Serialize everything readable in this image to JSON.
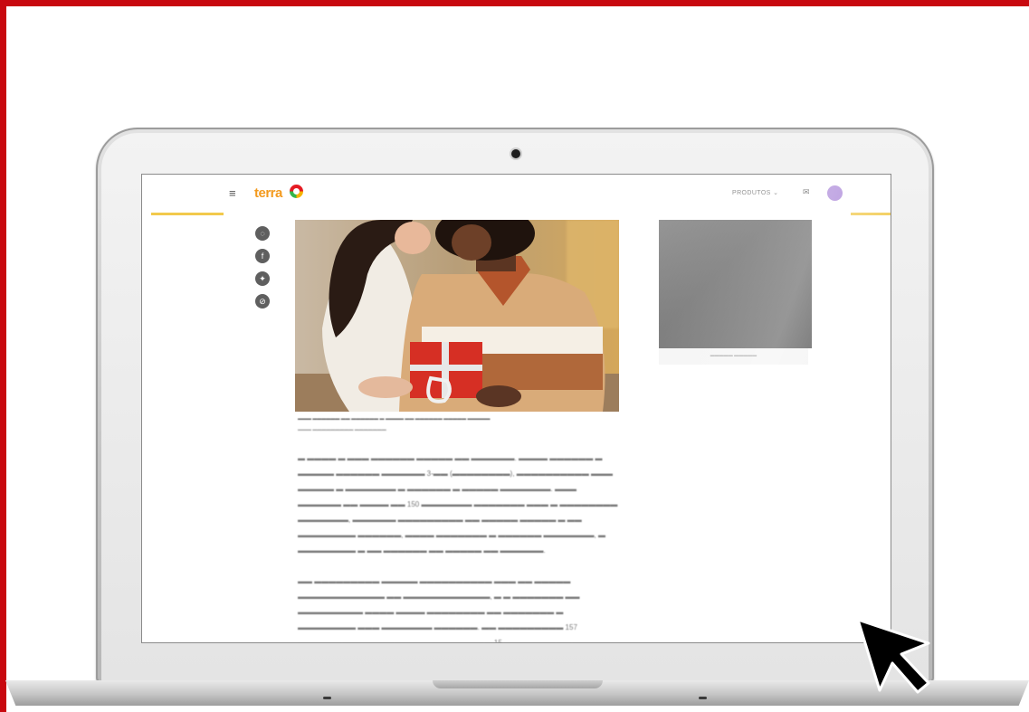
{
  "site": {
    "menu_icon": "hamburger-icon",
    "logo_text": "terra",
    "products_label": "PRODUTOS",
    "products_chevron": "⌄",
    "mail_icon": "mail-icon"
  },
  "share": [
    {
      "icon": "whatsapp-icon",
      "glyph": "◌"
    },
    {
      "icon": "facebook-icon",
      "glyph": "f"
    },
    {
      "icon": "twitter-icon",
      "glyph": "✦"
    },
    {
      "icon": "link-icon",
      "glyph": "⊘"
    }
  ],
  "colors": {
    "frame_red": "#c8080f",
    "logo_orange": "#f39a1e",
    "accent_yellow": "#f2c94c",
    "avatar_purple": "#a57fd6"
  }
}
